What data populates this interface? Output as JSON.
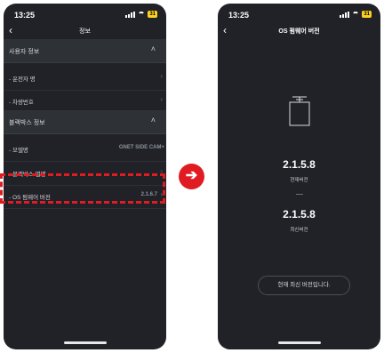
{
  "left_screen": {
    "status_time": "13:25",
    "battery": "31",
    "nav_title": "정보",
    "sections": [
      {
        "title": "사용자 정보",
        "rows": [
          {
            "label": "- 운전자 명",
            "value": ""
          },
          {
            "label": "- 차량번호",
            "value": ""
          }
        ]
      },
      {
        "title": "블랙박스 정보",
        "rows": [
          {
            "label": "- 모델명",
            "value": "GNET SIDE CAM+"
          },
          {
            "label": "- 블랙박스 별명",
            "value": ""
          },
          {
            "label": "- OS 펌웨어 버전",
            "value": "2.1.6.7"
          }
        ]
      }
    ]
  },
  "right_screen": {
    "status_time": "13:25",
    "battery": "31",
    "nav_title": "OS 펌웨어 버전",
    "current_version": "2.1.5.8",
    "current_caption": "현재버전",
    "latest_version": "2.1.5.8",
    "latest_caption": "최신버전",
    "status_button": "현재 최신 버전입니다."
  },
  "icons": {
    "back": "chevron-left-icon",
    "collapse": "chevron-up-icon",
    "row_arrow": "chevron-right-icon",
    "next": "arrow-right-circle-icon",
    "device": "dashcam-icon"
  },
  "colors": {
    "screen_bg": "#202227",
    "section_bg": "#2e3136",
    "highlight": "#e01b22"
  }
}
